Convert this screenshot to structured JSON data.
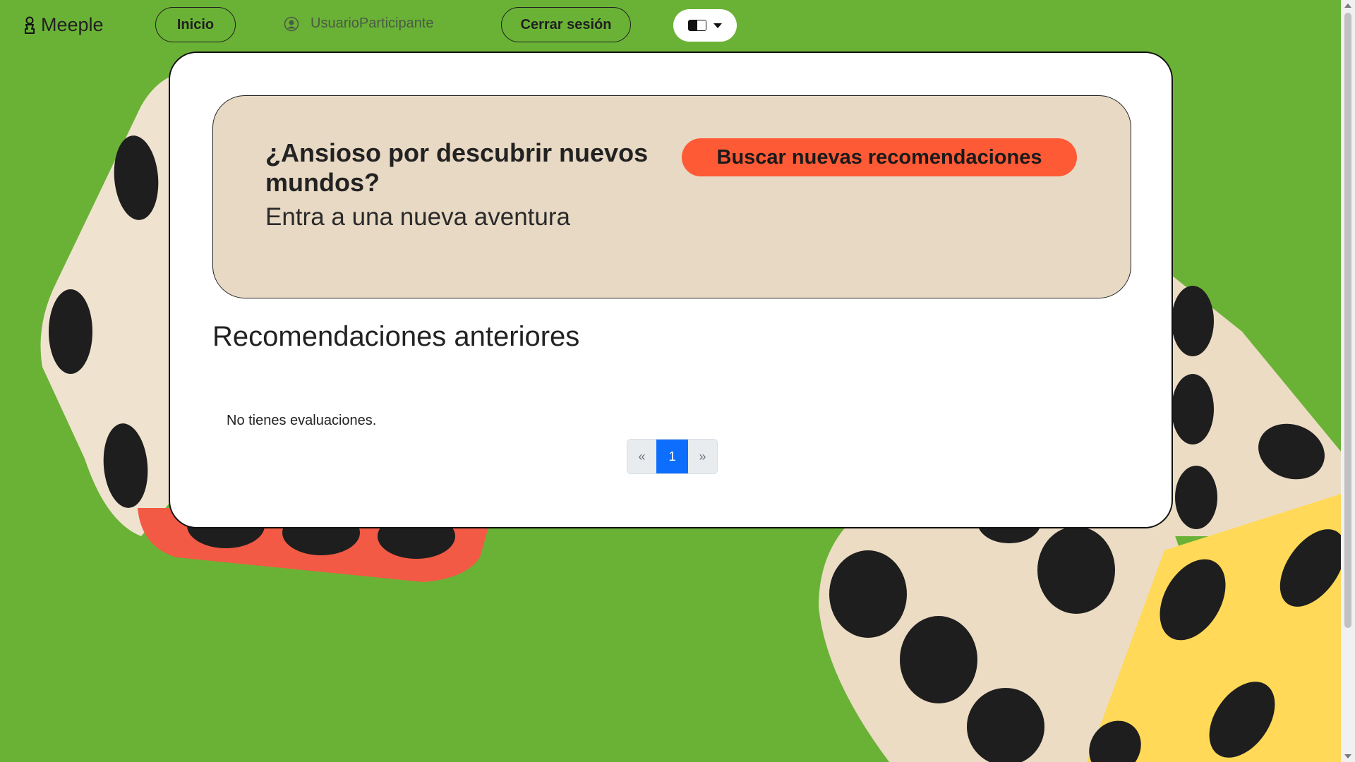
{
  "navbar": {
    "brand": "Meeple",
    "home_label": "Inicio",
    "username": "UsuarioParticipante",
    "logout_label": "Cerrar sesión",
    "language_icon": "translate-icon"
  },
  "promo": {
    "title": "¿Ansioso por descubrir nuevos mundos?",
    "subtitle": "Entra a una nueva aventura",
    "cta_label": "Buscar nuevas recomendaciones"
  },
  "history": {
    "title": "Recomendaciones anteriores",
    "empty_message": "No tienes evaluaciones."
  },
  "pagination": {
    "prev": "«",
    "current": "1",
    "next": "»"
  },
  "colors": {
    "background": "#6ab236",
    "promo_bg": "#e8d9c4",
    "cta": "#ff5a36",
    "active_page": "#0d6efd"
  }
}
